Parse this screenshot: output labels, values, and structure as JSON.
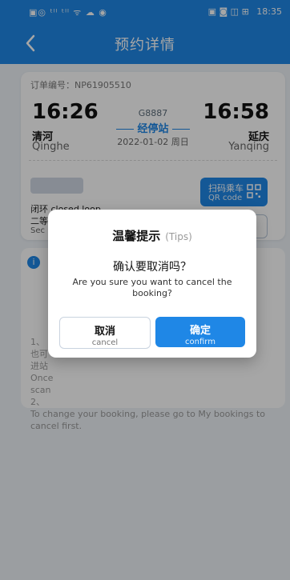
{
  "status_bar": {
    "left_icons": "▣◎ ᵗˡˡ ᵗˡˡ ᯤ ☁ ◉",
    "right_icons": "▣ ◙ ◫ ⊞",
    "time": "18:35"
  },
  "header": {
    "title": "预约详情"
  },
  "ticket": {
    "order_label": "订单编号：NP61905510",
    "depart_time": "16:26",
    "arrive_time": "16:58",
    "from_cn": "清河",
    "from_en": "Qinghe",
    "to_cn": "延庆",
    "to_en": "Yanqing",
    "train_no": "G8887",
    "stop_label": "经停站",
    "date": "2022-01-02 周日",
    "loop_text": "闭环 closed loop",
    "second_line_cn": "二等",
    "second_line_en": "Sec",
    "qr_button": {
      "cn": "扫码乘车",
      "en": "QR code"
    }
  },
  "tips_card": {
    "text_lines": [
      "1、",
      "也可",
      "进站",
      "Once",
      "scan",
      "2、",
      "To change your booking, please go to My bookings to",
      "cancel first."
    ]
  },
  "dialog": {
    "title_cn": "温馨提示",
    "title_en": "(Tips)",
    "question_cn": "确认要取消吗？",
    "question_en": "Are you sure you want to cancel the booking?",
    "cancel_cn": "取消",
    "cancel_en": "cancel",
    "confirm_cn": "确定",
    "confirm_en": "confirm"
  },
  "colors": {
    "primary": "#1f87e6",
    "background": "#eef3f8"
  }
}
